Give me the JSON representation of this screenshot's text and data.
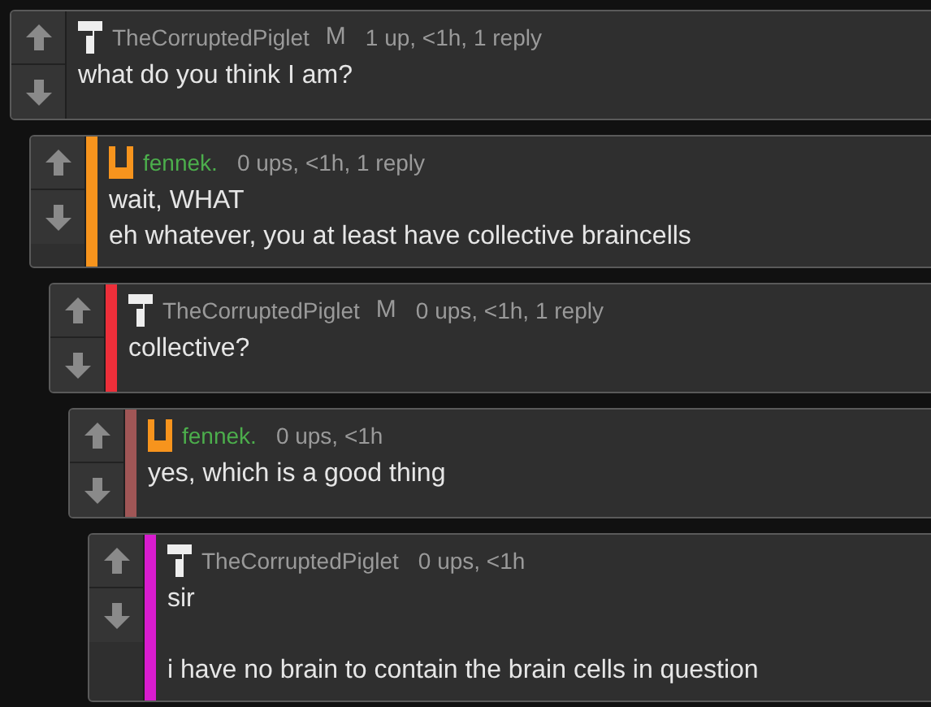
{
  "comments": [
    {
      "author": {
        "name": "TheCorruptedPiglet",
        "color": "#9a9a9a",
        "kind": "tee"
      },
      "badge": "M",
      "meta": "1 up, <1h, 1 reply",
      "text": "what do you think I am?",
      "children": [
        {
          "color": "#f7941d",
          "author": {
            "name": "fennek.",
            "color": "#4cae4c",
            "kind": "cup"
          },
          "meta": "0 ups, <1h, 1 reply",
          "text": "wait, WHAT\neh whatever, you at least have collective braincells",
          "children": [
            {
              "color": "#ee2f3a",
              "author": {
                "name": "TheCorruptedPiglet",
                "color": "#9a9a9a",
                "kind": "tee"
              },
              "badge": "M",
              "meta": "0 ups, <1h, 1 reply",
              "text": "collective?",
              "children": [
                {
                  "color": "#a05656",
                  "author": {
                    "name": "fennek.",
                    "color": "#4cae4c",
                    "kind": "cup"
                  },
                  "meta": "0 ups, <1h",
                  "text": "yes, which is a good thing",
                  "children": [
                    {
                      "color": "#d91ccf",
                      "author": {
                        "name": "TheCorruptedPiglet",
                        "color": "#9a9a9a",
                        "kind": "tee"
                      },
                      "meta": "0 ups, <1h",
                      "text": "sir\n\ni have no brain to contain the brain cells in question"
                    }
                  ]
                }
              ]
            }
          ]
        }
      ]
    }
  ]
}
